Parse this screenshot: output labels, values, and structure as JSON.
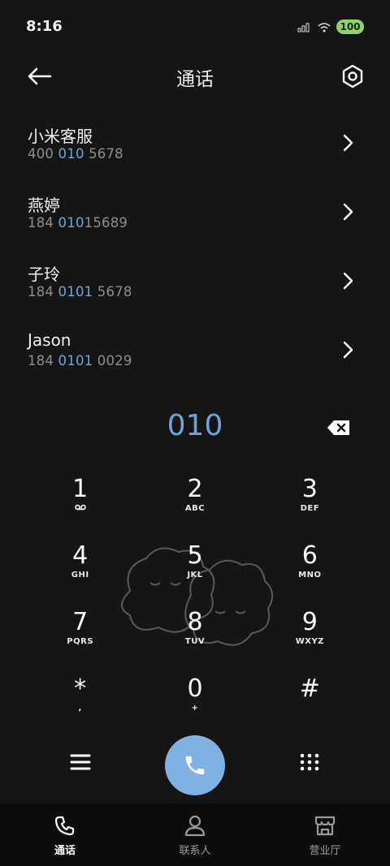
{
  "status": {
    "time": "8:16",
    "battery": "100"
  },
  "header": {
    "title": "通话"
  },
  "results": [
    {
      "name": "小米客服",
      "pre": "400 ",
      "hl": "010",
      "post": " 5678"
    },
    {
      "name": "燕婷",
      "pre": "184 ",
      "hl": "010",
      "post": "15689"
    },
    {
      "name": "子玲",
      "pre": "184 ",
      "hl": "0101",
      "post": " 5678"
    },
    {
      "name": "Jason",
      "pre": "184 ",
      "hl": "0101",
      "post": " 0029"
    }
  ],
  "dialer": {
    "input": "010"
  },
  "keys": [
    {
      "d": "1",
      "l": ""
    },
    {
      "d": "2",
      "l": "ABC"
    },
    {
      "d": "3",
      "l": "DEF"
    },
    {
      "d": "4",
      "l": "GHI"
    },
    {
      "d": "5",
      "l": "JKL"
    },
    {
      "d": "6",
      "l": "MNO"
    },
    {
      "d": "7",
      "l": "PQRS"
    },
    {
      "d": "8",
      "l": "TUV"
    },
    {
      "d": "9",
      "l": "WXYZ"
    },
    {
      "d": "*",
      "l": ","
    },
    {
      "d": "0",
      "l": "+"
    },
    {
      "d": "#",
      "l": ""
    }
  ],
  "nav": {
    "calls": "通话",
    "contacts": "联系人",
    "business": "营业厅"
  },
  "colors": {
    "accent": "#6ea4dc",
    "call_button": "#7fb1e2",
    "battery": "#8fd46a"
  },
  "icons": [
    "back-arrow-icon",
    "settings-icon",
    "chevron-right-icon",
    "backspace-icon",
    "voicemail-icon",
    "menu-icon",
    "phone-icon",
    "dialpad-icon",
    "person-icon",
    "store-icon"
  ]
}
